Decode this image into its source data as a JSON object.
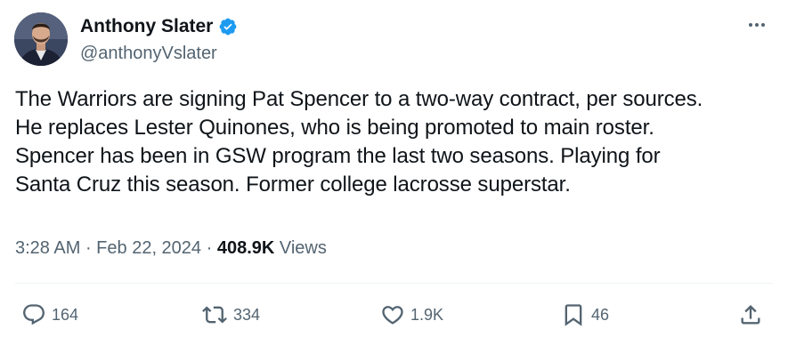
{
  "author": {
    "display_name": "Anthony Slater",
    "handle": "@anthonyVslater",
    "verified": true
  },
  "tweet": {
    "lines": [
      "The Warriors are signing Pat Spencer to a two-way contract, per sources.",
      "He replaces Lester Quinones, who is being promoted to main roster.",
      "Spencer has been in GSW program the last two seasons. Playing for",
      "Santa Cruz this season. Former college lacrosse superstar."
    ]
  },
  "meta": {
    "time": "3:28 AM",
    "separator": " · ",
    "date": "Feb 22, 2024",
    "views_count": "408.9K",
    "views_label": " Views"
  },
  "actions": {
    "replies": "164",
    "reposts": "334",
    "likes": "1.9K",
    "bookmarks": "46"
  },
  "colors": {
    "text_primary": "#0f1419",
    "text_secondary": "#536471",
    "verified_blue": "#1d9bf0",
    "divider": "#eff3f4"
  },
  "icons": {
    "more": "more-icon",
    "reply": "reply-icon",
    "repost": "repost-icon",
    "like": "like-icon",
    "bookmark": "bookmark-icon",
    "share": "share-icon",
    "verified": "verified-badge-icon"
  }
}
